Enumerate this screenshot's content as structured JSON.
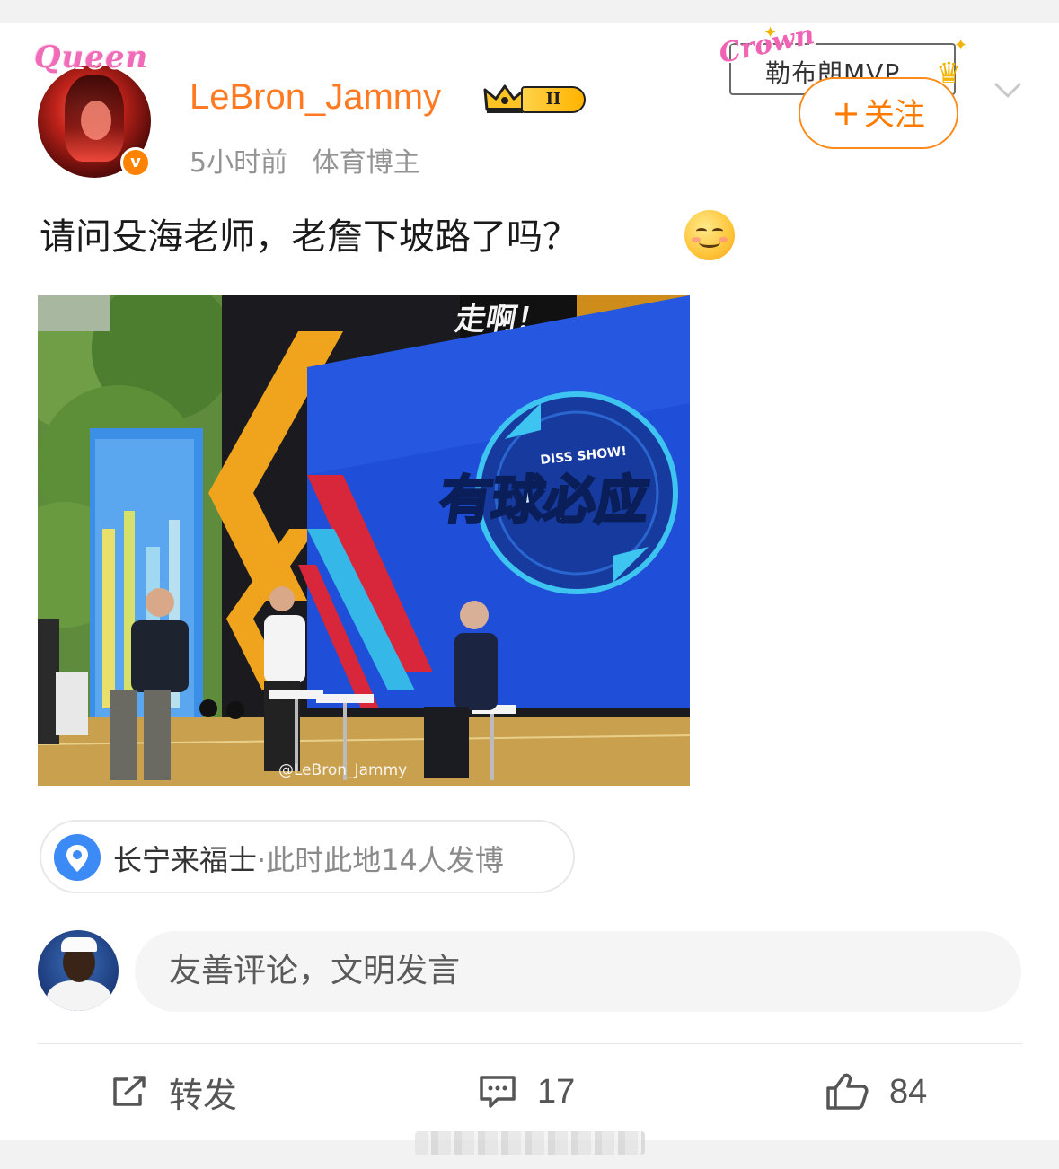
{
  "post": {
    "user": {
      "name": "LeBron_Jammy",
      "avatar_frame_text": "Queen",
      "level_badge": "II",
      "time": "5小时前",
      "tag": "体育博主"
    },
    "decoration": {
      "crown_text": "Crown",
      "title_text": "勒布朗MVP"
    },
    "follow_label": "关注",
    "follow_plus": "+",
    "text": "请问殳海老师，老詹下坡路了吗？",
    "image": {
      "top_banner_text": "走啊！",
      "show_subtitle": "DISS SHOW!",
      "show_title": "有球必应",
      "watermark": "@LeBron_Jammy"
    },
    "location": {
      "name": "长宁来福士",
      "sub": "·此时此地14人发博"
    }
  },
  "comment_box": {
    "placeholder": "友善评论，文明发言"
  },
  "actions": {
    "repost_label": "转发",
    "comment_count": "17",
    "like_count": "84"
  },
  "colors": {
    "username": "#ff7a22",
    "follow": "#ff7a00",
    "location_icon": "#3b8af5",
    "stage_blue": "#1f4fd8",
    "stage_yellow": "#f0a31c"
  }
}
